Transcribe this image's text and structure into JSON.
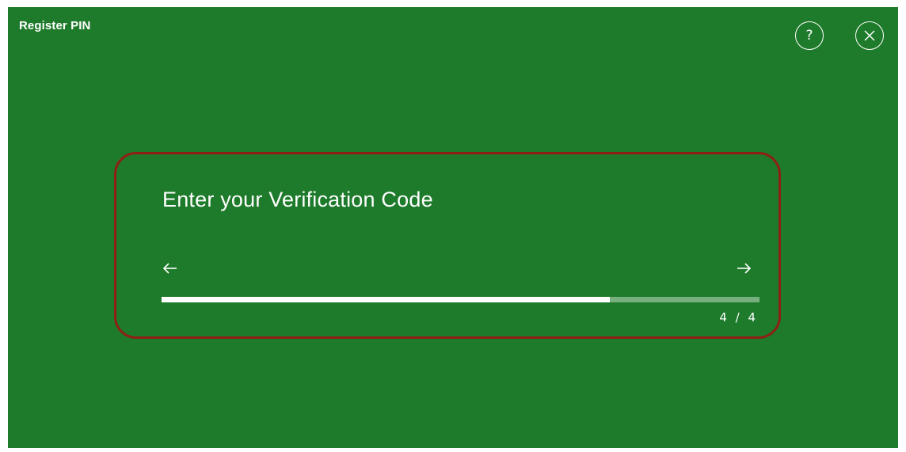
{
  "window": {
    "title": "Register PIN"
  },
  "header": {
    "help_icon": "question-circle-icon",
    "close_icon": "close-circle-icon"
  },
  "card": {
    "heading": "Enter your Verification Code",
    "back_icon": "arrow-left-icon",
    "next_icon": "arrow-right-icon",
    "progress_fraction": 0.75,
    "step_label": "4 / 4"
  },
  "colors": {
    "background": "#1e7b2b",
    "highlight_border": "#8f1f15",
    "foreground": "#ffffff"
  }
}
